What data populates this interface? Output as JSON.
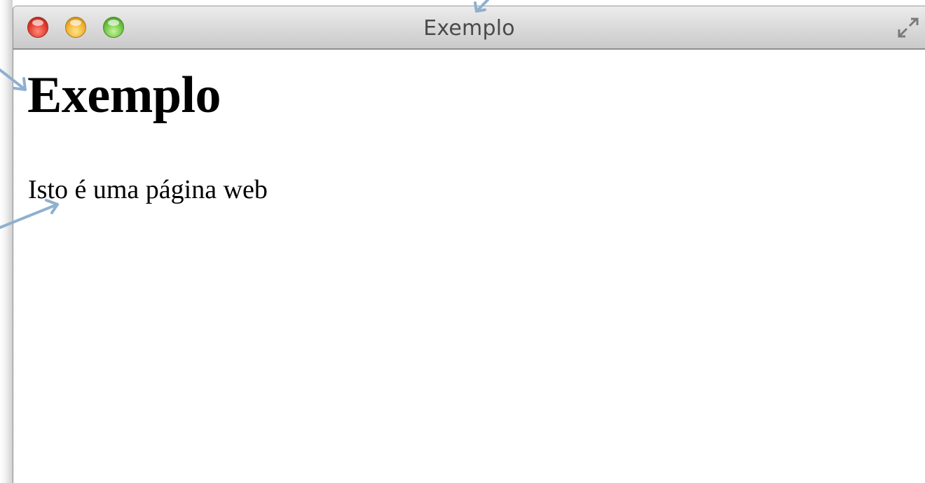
{
  "window": {
    "title": "Exemplo",
    "controls": {
      "close_color": "#e0392b",
      "minimize_color": "#f0b030",
      "zoom_color": "#6cc240",
      "fullscreen_icon": "fullscreen-icon"
    }
  },
  "page": {
    "heading": "Exemplo",
    "paragraph": "Isto é uma página web"
  },
  "annotation_color": "#8fb0cf"
}
